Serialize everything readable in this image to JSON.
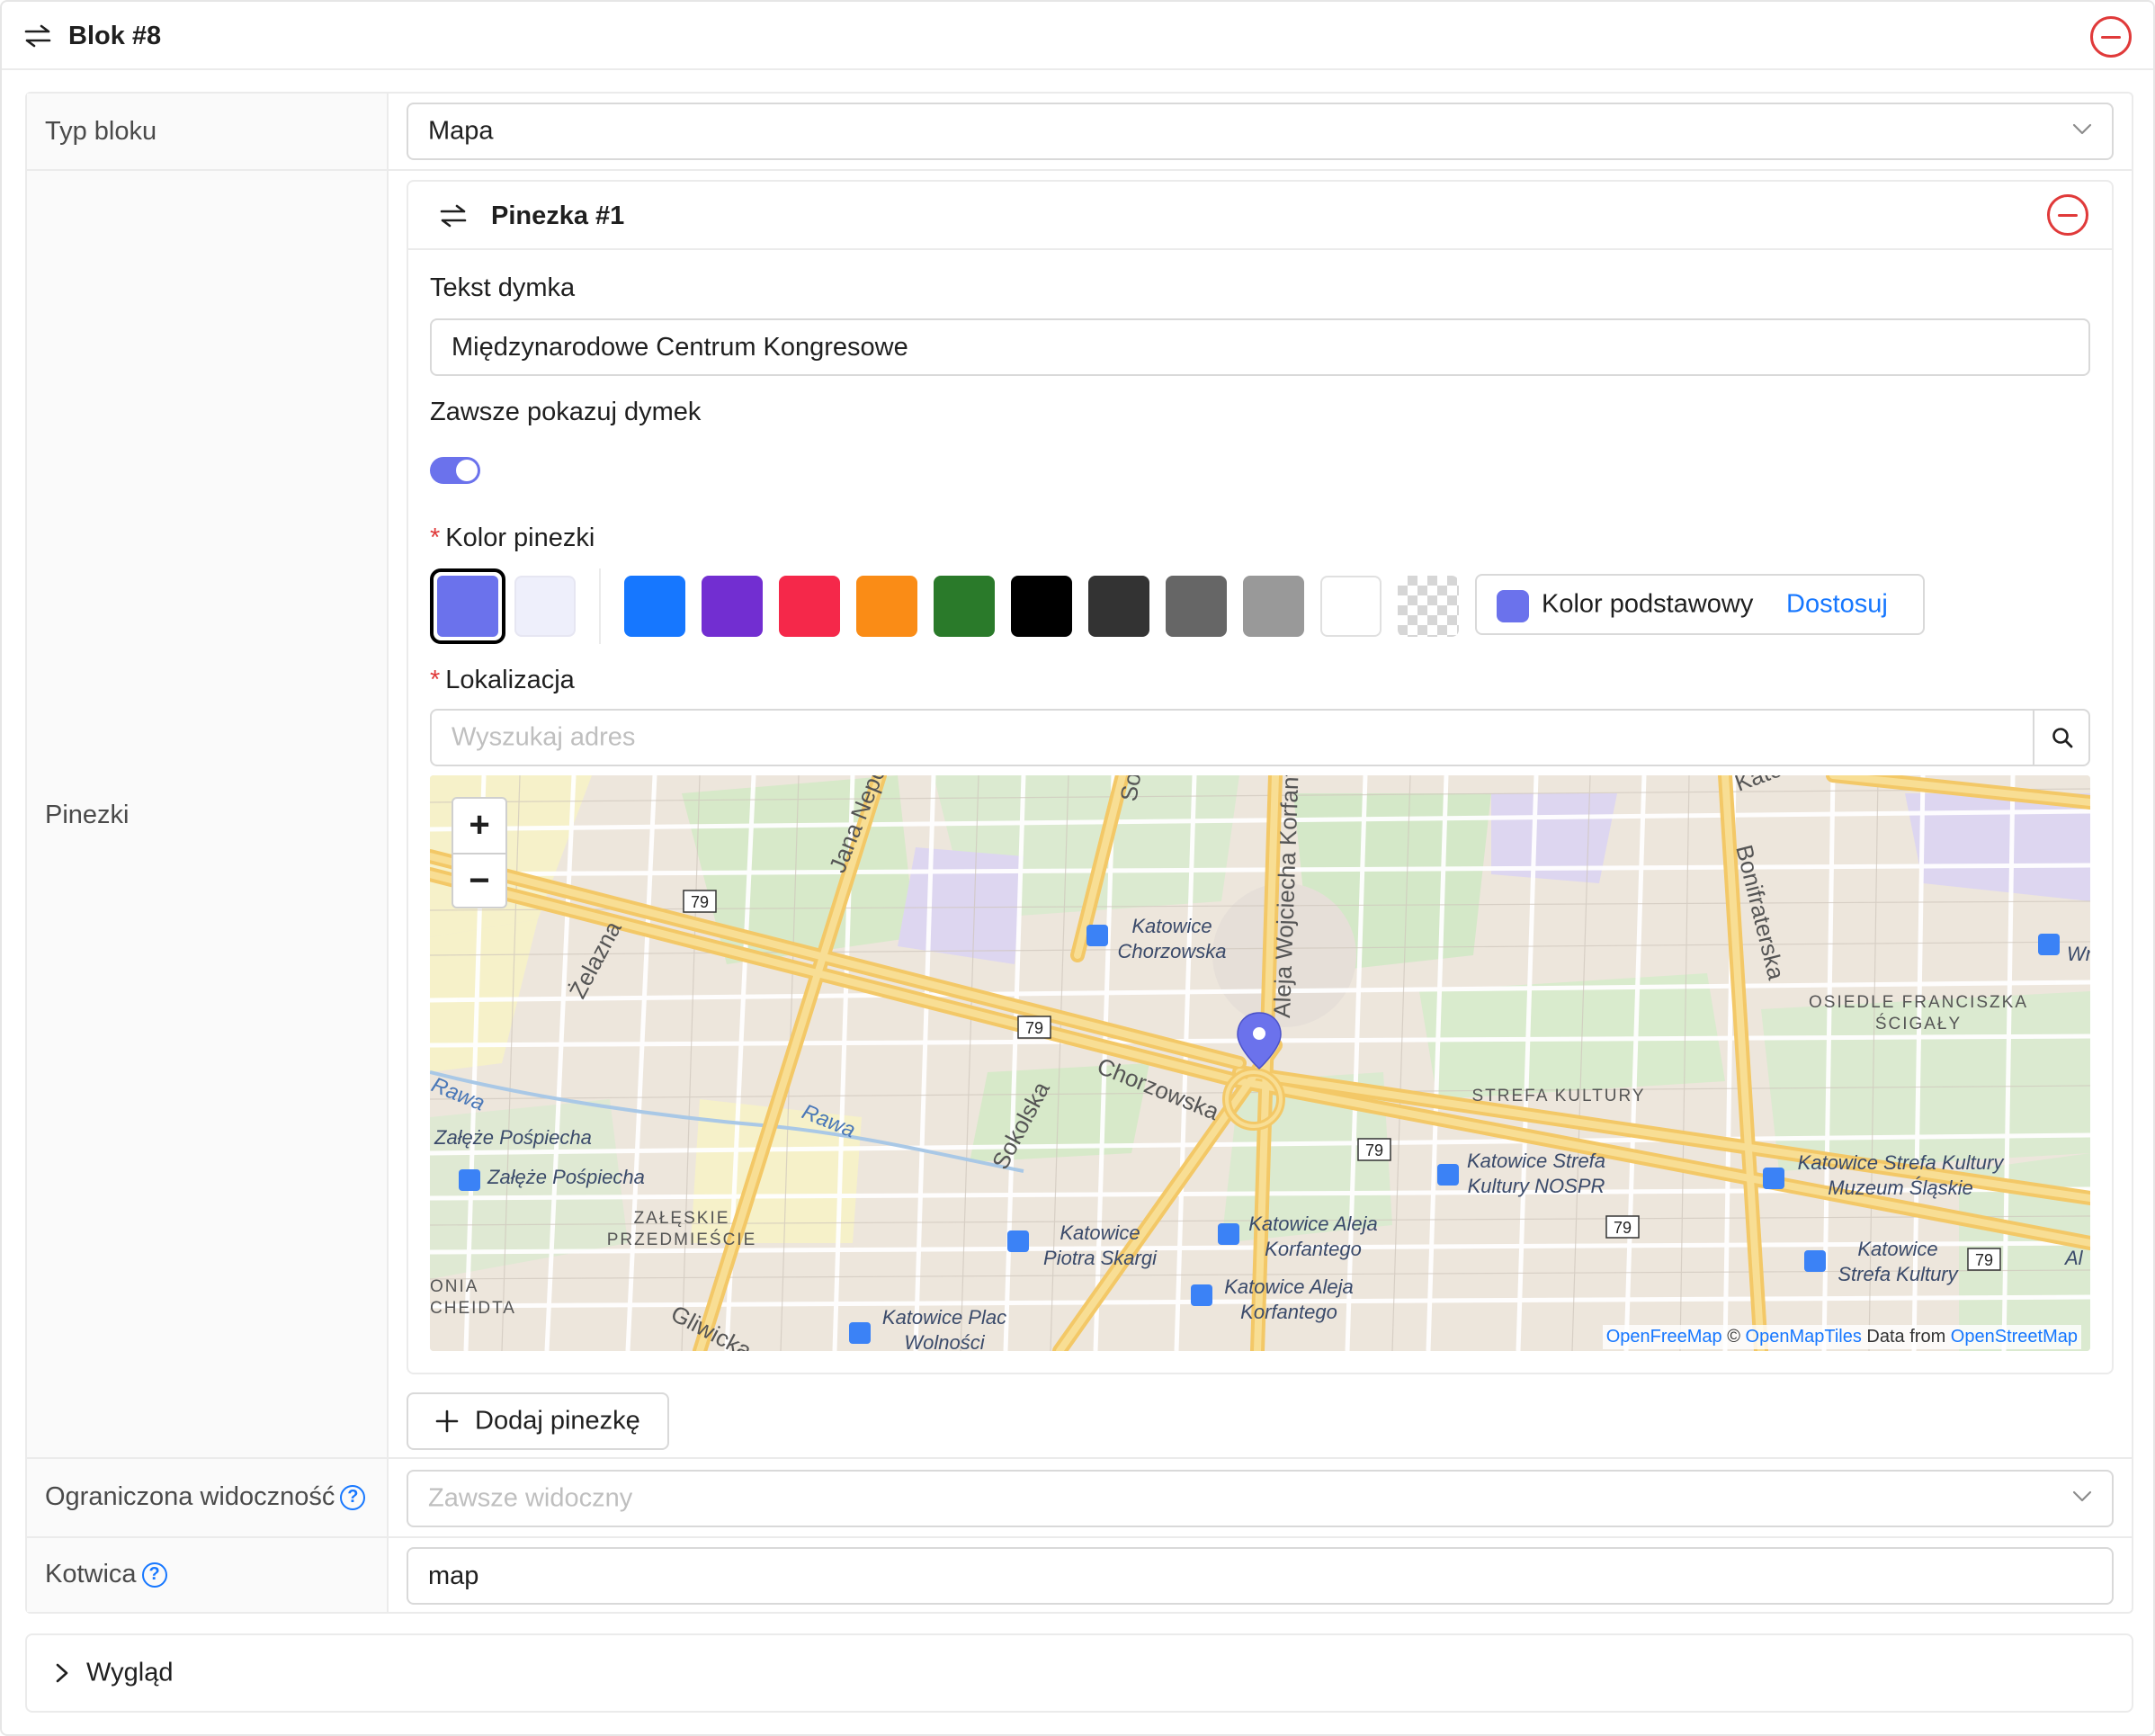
{
  "block": {
    "title": "Blok #8"
  },
  "rows": {
    "block_type": {
      "label": "Typ bloku",
      "value": "Mapa"
    },
    "pins": {
      "label": "Pinezki"
    },
    "visibility": {
      "label": "Ograniczona widoczność",
      "placeholder": "Zawsze widoczny"
    },
    "anchor": {
      "label": "Kotwica",
      "value": "map"
    }
  },
  "pin": {
    "title": "Pinezka #1",
    "tooltip_label": "Tekst dymka",
    "tooltip_value": "Międzynarodowe Centrum Kongresowe",
    "always_show_label": "Zawsze pokazuj dymek",
    "always_show_on": true,
    "required_mark": "*",
    "color_label": "Kolor pinezki",
    "colors": {
      "selected": "#6b72ec",
      "light": "#eeeffb",
      "palette": [
        "#1677ff",
        "#722ed1",
        "#f5284a",
        "#fa8c16",
        "#2a7a2a",
        "#000000",
        "#333333",
        "#666666",
        "#999999",
        "#ffffff",
        "transparent"
      ]
    },
    "custom_color": {
      "label": "Kolor podstawowy",
      "link": "Dostosuj",
      "color": "#6b72ec"
    },
    "location_label": "Lokalizacja",
    "search_placeholder": "Wyszukaj adres"
  },
  "map": {
    "zoom_in": "+",
    "zoom_out": "−",
    "attribution": {
      "a1": "OpenFreeMap",
      "sep": " © ",
      "a2": "OpenMapTiles",
      "mid": " Data from ",
      "a3": "OpenStreetMap"
    },
    "labels": {
      "jana": "Jana Nepom",
      "so": "So",
      "korfantego": "Aleja Wojciecha Korfante",
      "bonifraterska": "Bonifraterska",
      "kato": "Kato",
      "zelazna": "Żelazna",
      "chorzowska": "Chorzowska",
      "sokolska": "Sokolska",
      "rawa1": "Rawa",
      "rawa2": "Rawa",
      "gliwicka": "Gliwicka",
      "kc1": "Katowice",
      "kc2": "Chorzowska",
      "of1": "OSIEDLE FRANCISZKA",
      "of2": "ŚCIGAŁY",
      "wr": "Wr",
      "strefa": "STREFA KULTURY",
      "kn1": "Katowice Strefa",
      "kn2": "Kultury NOSPR",
      "km1": "Katowice Strefa Kultury",
      "km2": "Muzeum Śląskie",
      "zp1": "Załęże Pośpiecha",
      "zp2": "Załęże Pośpiecha",
      "zpm1": "ZAŁĘSKIE",
      "zpm2": "PRZEDMIEŚCIE",
      "kps1": "Katowice",
      "kps2": "Piotra Skargi",
      "kak1": "Katowice Aleja",
      "kak2": "Korfantego",
      "kak3": "Katowice Aleja",
      "kak4": "Korfantego",
      "ksk1": "Katowice",
      "ksk2": "Strefa Kultury",
      "al": "Al",
      "kpw1": "Katowice Plac",
      "kpw2": "Wolności",
      "onia1": "ONIA",
      "onia2": "CHEIDTA",
      "r79": "79"
    }
  },
  "add_pin": {
    "label": "Dodaj pinezkę"
  },
  "appearance": {
    "label": "Wygląd"
  },
  "icons": {
    "drag": "swap-arrows-icon",
    "remove": "minus-circle-icon",
    "chevron": "chevron-down-icon",
    "search": "search-icon",
    "help": "question-circle-icon",
    "plus": "plus-icon",
    "expand": "chevron-right-icon",
    "map_pin": "map-pin-icon",
    "bus": "bus-stop-icon"
  },
  "accent": "#1677ff",
  "danger": "#e03a3a"
}
